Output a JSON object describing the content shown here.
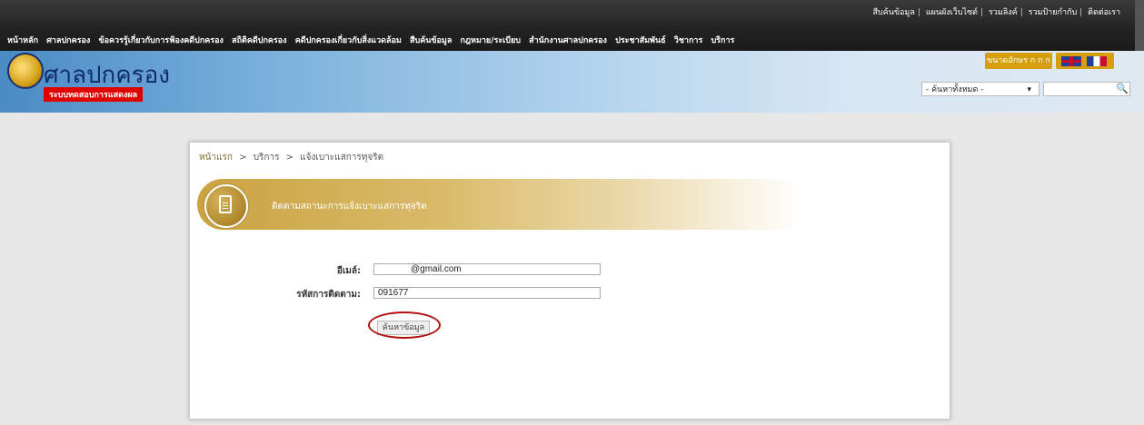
{
  "top_links": [
    "สืบค้นข้อมูล",
    "แผนผังเว็บไซต์",
    "รวมลิงค์",
    "รวมป้ายกำกับ",
    "ติดต่อเรา"
  ],
  "main_nav": [
    "หน้าหลัก",
    "ศาลปกครอง",
    "ข้อควรรู้เกี่ยวกับการฟ้องคดีปกครอง",
    "สถิติคดีปกครอง",
    "คดีปกครองเกี่ยวกับสิ่งแวดล้อม",
    "สืบค้นข้อมูล",
    "กฎหมาย/ระเบียบ",
    "สำนักงานศาลปกครอง",
    "ประชาสัมพันธ์",
    "วิชาการ",
    "บริการ"
  ],
  "logo": {
    "name": "ศาลปกครอง",
    "subtitle": "ระบบทดสอบการแสดงผล"
  },
  "font_size_label": "ขนาดอักษร ก ก ก",
  "search_scope": "- ค้นหาทั้งหมด -",
  "breadcrumb": {
    "home": "หน้าแรก",
    "level2": "บริการ",
    "level3": "แจ้งเบาะแสการทุจริต"
  },
  "panel_title": "ติดตามสถานะการแจ้งเบาะแสการทุจริต",
  "form": {
    "email_label": "อีเมล์:",
    "email_value": "@gmail.com",
    "tracking_label": "รหัสการติดตาม:",
    "tracking_value": "091677",
    "search_button": "ค้นหาข้อมูล"
  }
}
